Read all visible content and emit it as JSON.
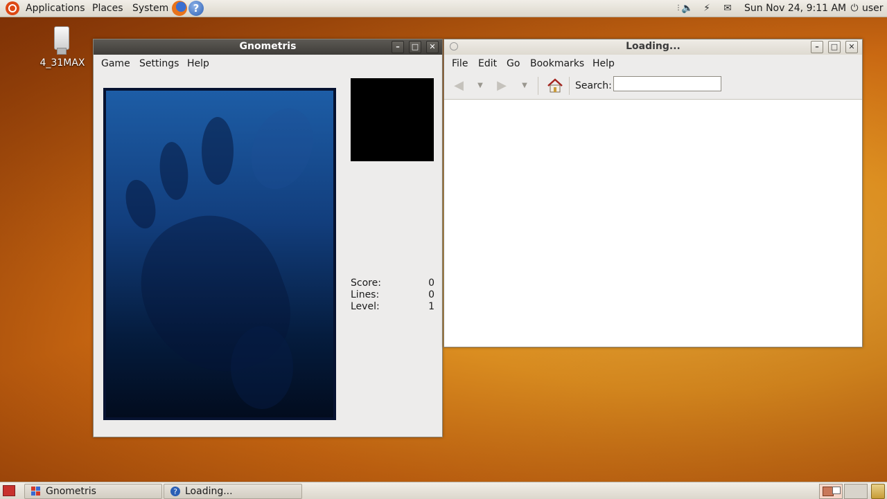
{
  "top_panel": {
    "menus": [
      "Applications",
      "Places",
      "System"
    ],
    "clock": "Sun Nov 24,  9:11 AM",
    "user": "user",
    "icons": [
      "ubuntu-logo",
      "firefox-icon",
      "help-icon",
      "volume-icon",
      "network-icon",
      "mail-icon",
      "power-icon"
    ]
  },
  "desktop": {
    "icon_label": "4_31MAX"
  },
  "gnometris": {
    "title": "Gnometris",
    "menus": [
      "Game",
      "Settings",
      "Help"
    ],
    "stats": [
      {
        "label": "Score:",
        "value": "0"
      },
      {
        "label": "Lines:",
        "value": "0"
      },
      {
        "label": "Level:",
        "value": "1"
      }
    ]
  },
  "browser": {
    "title": "Loading...",
    "menus": [
      "File",
      "Edit",
      "Go",
      "Bookmarks",
      "Help"
    ],
    "search_label": "Search:",
    "search_value": ""
  },
  "taskbar": {
    "tasks": [
      "Gnometris",
      "Loading..."
    ]
  },
  "colors": {
    "accent": "#dd4814",
    "titlebar_active": "#4a4843",
    "board_top": "#1d5da6",
    "board_bottom": "#020c1e"
  }
}
